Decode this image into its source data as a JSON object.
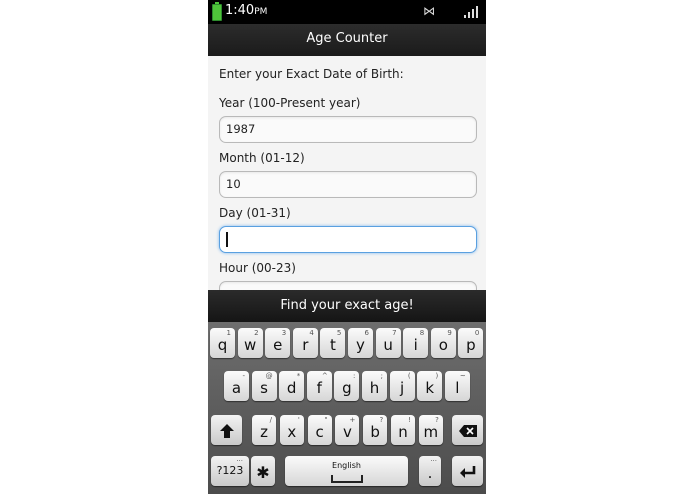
{
  "status": {
    "time": "1:40",
    "ampm": "PM"
  },
  "titlebar": {
    "title": "Age Counter"
  },
  "form": {
    "instruction": "Enter your Exact Date of Birth:",
    "fields": [
      {
        "label": "Year (100-Present year)",
        "value": "1987"
      },
      {
        "label": "Month (01-12)",
        "value": "10"
      },
      {
        "label": "Day (01-31)",
        "value": ""
      },
      {
        "label": "Hour (00-23)",
        "value": ""
      }
    ]
  },
  "find_button": {
    "label": "Find your exact age!"
  },
  "keyboard": {
    "row1": [
      {
        "k": "q",
        "s": "1"
      },
      {
        "k": "w",
        "s": "2"
      },
      {
        "k": "e",
        "s": "3"
      },
      {
        "k": "r",
        "s": "4"
      },
      {
        "k": "t",
        "s": "5"
      },
      {
        "k": "y",
        "s": "6"
      },
      {
        "k": "u",
        "s": "7"
      },
      {
        "k": "i",
        "s": "8"
      },
      {
        "k": "o",
        "s": "9"
      },
      {
        "k": "p",
        "s": "0"
      }
    ],
    "row2": [
      {
        "k": "a",
        "s": "-"
      },
      {
        "k": "s",
        "s": "@"
      },
      {
        "k": "d",
        "s": "*"
      },
      {
        "k": "f",
        "s": "^"
      },
      {
        "k": "g",
        "s": ":"
      },
      {
        "k": "h",
        "s": ";"
      },
      {
        "k": "j",
        "s": "("
      },
      {
        "k": "k",
        "s": ")"
      },
      {
        "k": "l",
        "s": "~"
      }
    ],
    "row3": [
      {
        "k": "z",
        "s": "/"
      },
      {
        "k": "x",
        "s": "'"
      },
      {
        "k": "c",
        "s": "\""
      },
      {
        "k": "v",
        "s": "+"
      },
      {
        "k": "b",
        "s": "?"
      },
      {
        "k": "n",
        "s": "!"
      },
      {
        "k": "m",
        "s": "?"
      }
    ],
    "symbols_label": "?123",
    "space_label": "English",
    "period_label": "."
  },
  "icons": {
    "shift": "shift-icon",
    "backspace": "backspace-icon",
    "settings": "gear-icon",
    "enter": "enter-icon"
  }
}
